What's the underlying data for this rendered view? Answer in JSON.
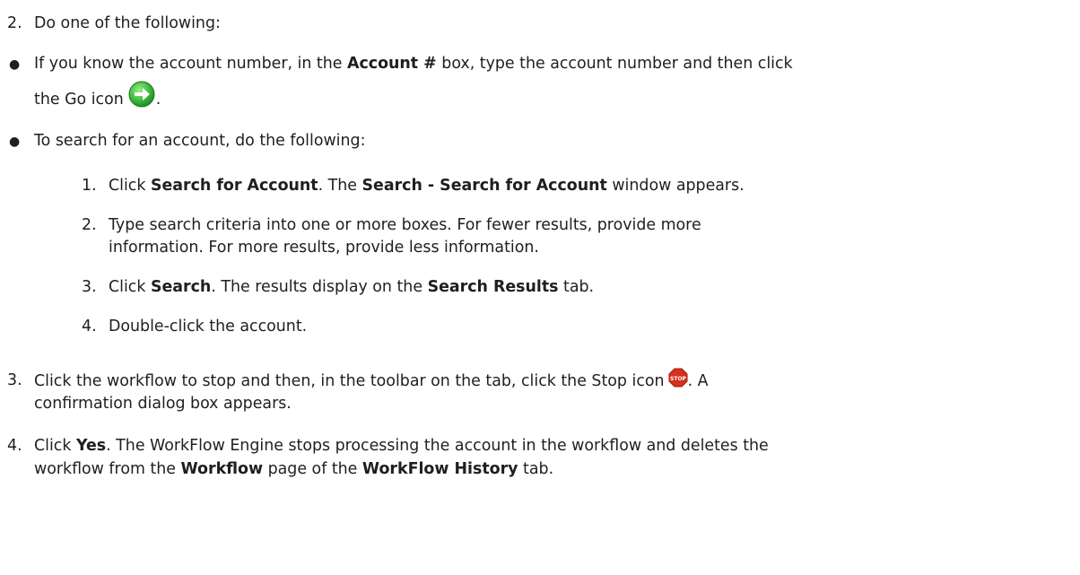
{
  "steps": {
    "s2": {
      "num": "2.",
      "text": "Do one of the following:"
    },
    "opt1": {
      "pre": "If you know the account number, in the ",
      "b1": "Account #",
      "mid": " box, type the account number and then click",
      "line2": "the Go icon",
      "end": "."
    },
    "opt2": {
      "text": "To search for an account, do the following:"
    },
    "sub": [
      {
        "num": "1.",
        "a": "Click ",
        "b": "Search for Account",
        "c": ". The ",
        "d": "Search - Search for Account",
        "e": " window appears."
      },
      {
        "num": "2.",
        "l1": "Type search criteria into one or more boxes. For fewer results, provide more",
        "l2": "information. For more results, provide less information."
      },
      {
        "num": "3.",
        "a": "Click ",
        "b": "Search",
        "c": ". The results display on the ",
        "d": "Search Results",
        "e": " tab."
      },
      {
        "num": "4.",
        "text": "Double-click the account."
      }
    ],
    "s3": {
      "num": "3.",
      "l1a": "Click the workflow to stop and then, in the toolbar on the tab, click the Stop icon",
      "l1b": ". A",
      "l2": "confirmation dialog box appears."
    },
    "s4": {
      "num": "4.",
      "l1a": "Click ",
      "l1b": "Yes",
      "l1c": ". The WorkFlow Engine stops processing the account in the workflow and deletes the",
      "l2a": "workflow from the ",
      "l2b": "Workflow",
      "l2c": " page of the ",
      "l2d": "WorkFlow History",
      "l2e": " tab."
    }
  },
  "icons": {
    "go": "go-arrow-icon",
    "stop": "stop-sign-icon",
    "go_color": "#3cb83c",
    "stop_color": "#d8301c"
  }
}
